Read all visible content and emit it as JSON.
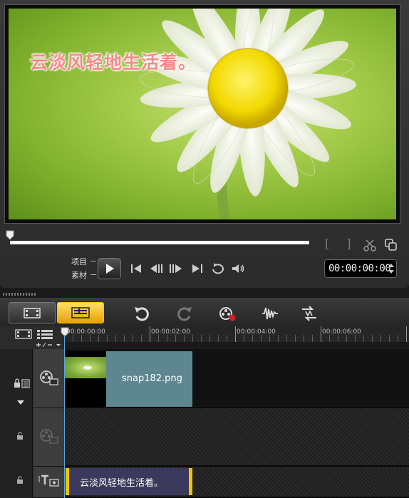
{
  "preview": {
    "title_text": "云淡风轻地生活着。"
  },
  "player": {
    "mode_project": "项目",
    "mode_clip": "素材",
    "timecode": "00:00:00:00",
    "bracket_in": "[",
    "bracket_out": "]"
  },
  "icons": {
    "play": "play-icon",
    "home": "go-to-start-icon",
    "prev_frame": "previous-frame-icon",
    "next_frame": "next-frame-icon",
    "end": "go-to-end-icon",
    "repeat": "repeat-icon",
    "volume": "volume-icon",
    "scissors": "split-clip-icon",
    "enlarge": "enlarge-preview-icon",
    "undo": "undo-icon",
    "redo": "redo-icon",
    "record": "record-capture-icon",
    "audio": "sound-mixer-icon",
    "automusic": "auto-music-icon"
  },
  "timeline": {
    "ruler_labels": [
      "00:00:00:00",
      "00:00:02:00",
      "00:00:04:00",
      "00:00:06:00"
    ],
    "tracks": {
      "video": {
        "clip_label": "snap182.png"
      },
      "overlay": {},
      "title": {
        "clip_label": "云淡风轻地生活着。"
      }
    }
  },
  "colors": {
    "accent_yellow": "#f5c400",
    "video_clip": "#5e8690",
    "title_clip": "#3b3a5c",
    "playhead": "#5ba7d8",
    "preview_text": "#f58a8a"
  }
}
